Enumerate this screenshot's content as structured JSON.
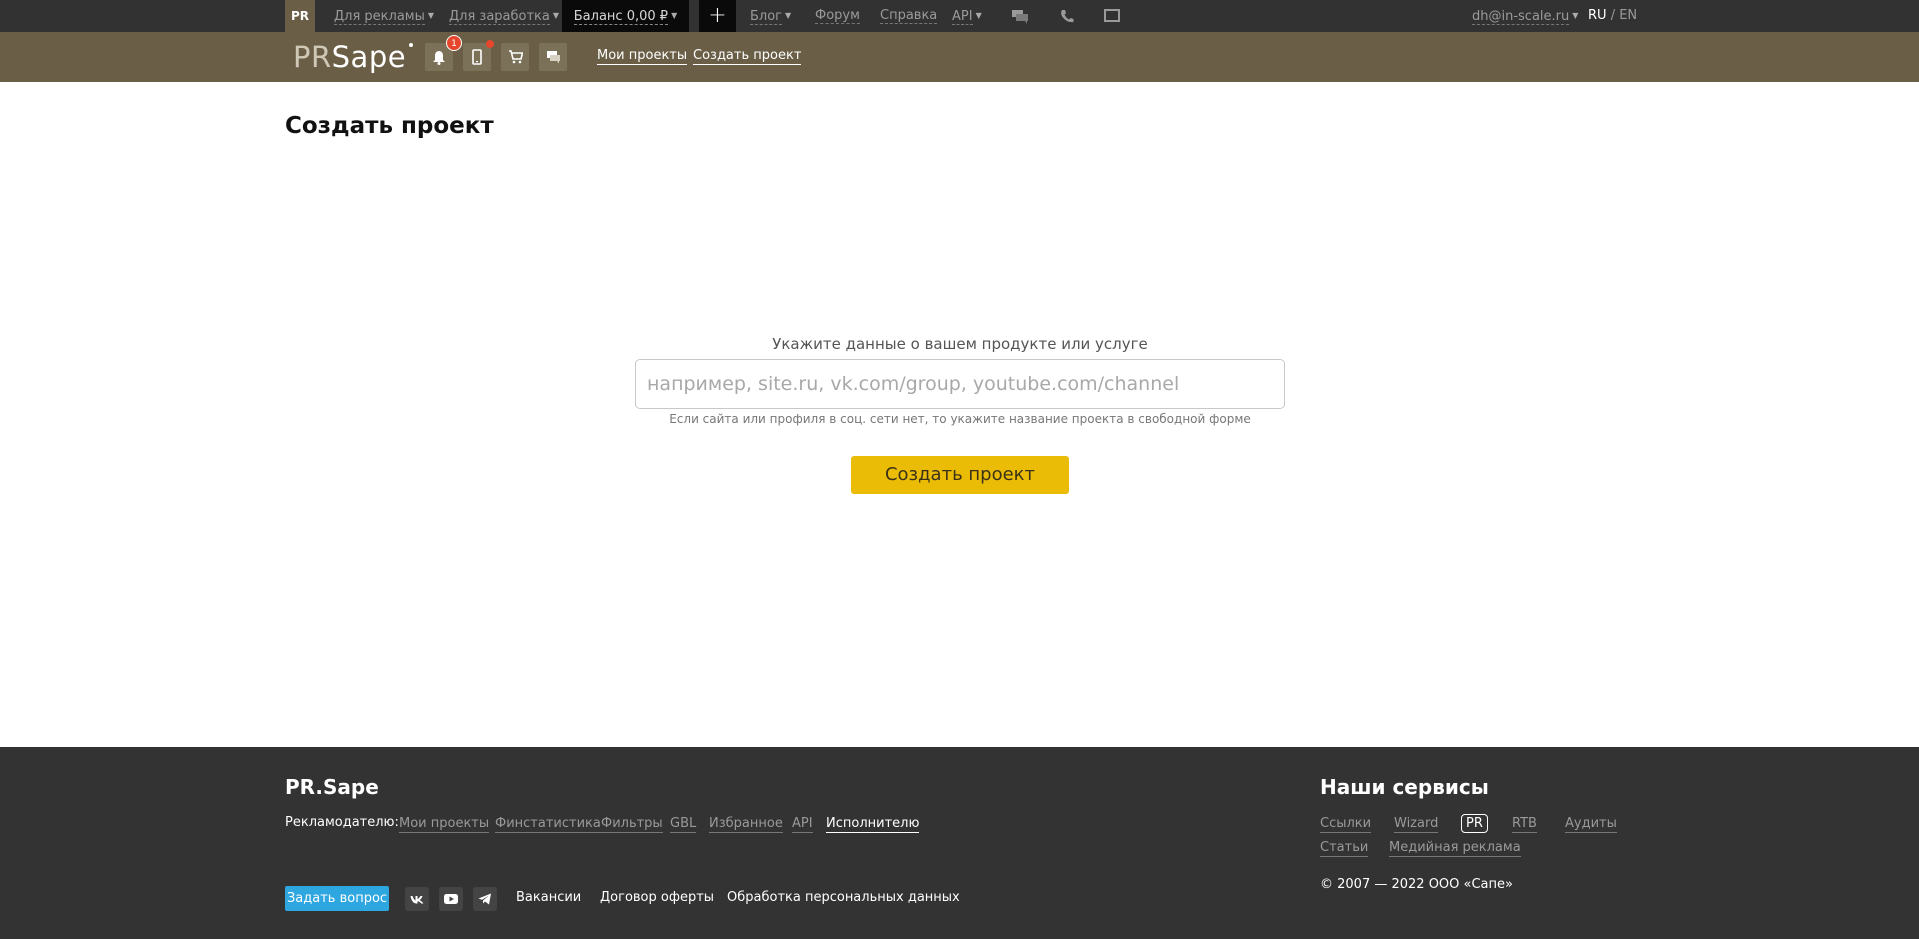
{
  "topbar": {
    "pr_label": "PR",
    "for_ads": "Для рекламы",
    "for_earning": "Для заработка",
    "balance": "Баланс 0,00 ₽",
    "plus": "+",
    "blog": "Блог",
    "forum": "Форум",
    "help": "Справка",
    "api": "API",
    "user_email": "dh@in-scale.ru",
    "lang_ru": "RU",
    "lang_sep": " / ",
    "lang_en": "EN",
    "icons": [
      "chat-bubbles-icon",
      "phone-icon",
      "screen-icon"
    ]
  },
  "header": {
    "logo_pr": "PR",
    "logo_sape": "Sape",
    "notifications_count": "1",
    "nav": [
      "Мои проекты",
      "Создать проект"
    ]
  },
  "main": {
    "title": "Создать проект",
    "form_label": "Укажите данные о вашем продукте или услуге",
    "input_placeholder": "например, site.ru, vk.com/group, youtube.com/channel",
    "input_value": "",
    "hint": "Если сайта или профиля в соц. сети нет, то укажите название проекта в свободной форме",
    "submit": "Создать проект",
    "accent_color": "#ebbc06"
  },
  "footer": {
    "brand": "PR.Sape",
    "advertiser_label": "Рекламодателю:",
    "advertiser_links": [
      "Мои проекты",
      "Финстатистика",
      "Фильтры",
      "GBL",
      "Избранное",
      "API",
      "Исполнителю"
    ],
    "ask_button": "Задать вопрос",
    "bottom_links": [
      "Вакансии",
      "Договор оферты",
      "Обработка персональных данных"
    ],
    "services_title": "Наши сервисы",
    "services": [
      "Ссылки",
      "Wizard",
      "PR",
      "RTB",
      "Аудиты",
      "Статьи",
      "Медийная реклама"
    ],
    "copyright": "© 2007 — 2022 ООО «Сапе»"
  }
}
